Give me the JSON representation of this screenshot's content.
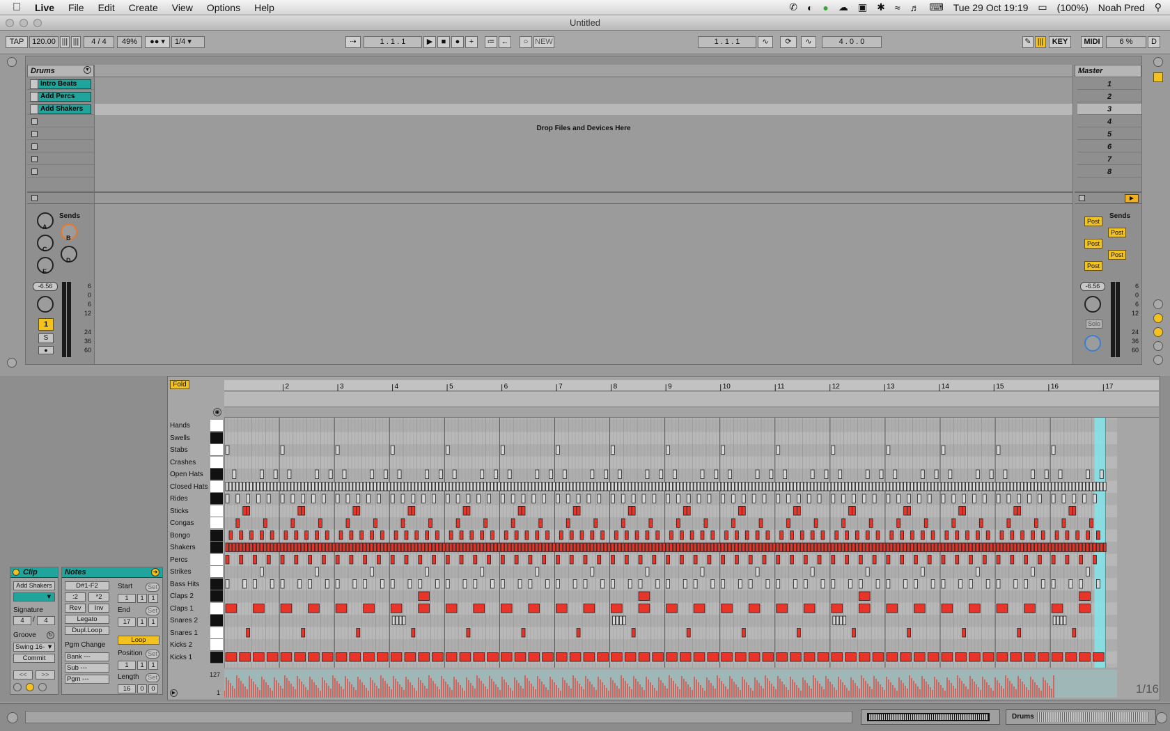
{
  "menubar": {
    "app": "Live",
    "items": [
      "File",
      "Edit",
      "Create",
      "View",
      "Options",
      "Help"
    ],
    "clock": "Tue 29 Oct  19:19",
    "battery": "(100%)",
    "user": "Noah Pred"
  },
  "window": {
    "title": "Untitled"
  },
  "transport": {
    "tap": "TAP",
    "tempo": "120.00",
    "signature": "4 / 4",
    "cpu_zoom": "49%",
    "quantize": "1/4",
    "song_position": "1 .  1 .  1",
    "new": "NEW",
    "loop_start": "1 .  1 .  1",
    "loop_length": "4 .  0 .  0",
    "key": "KEY",
    "midi": "MIDI",
    "cpu": "6 %",
    "d": "D"
  },
  "session": {
    "track_name": "Drums",
    "master_name": "Master",
    "clips": [
      "Intro Beats",
      "Add Percs",
      "Add Shakers"
    ],
    "drop_text": "Drop Files and Devices Here",
    "scenes": [
      "1",
      "2",
      "3",
      "4",
      "5",
      "6",
      "7",
      "8"
    ],
    "sends_label": "Sends",
    "send_knobs": [
      "A",
      "B",
      "C",
      "D",
      "E"
    ],
    "volume": "-6.56",
    "master_volume": "-6.56",
    "track_number": "1",
    "solo": "S",
    "master_solo": "Solo",
    "post": [
      "Post",
      "Post",
      "Post",
      "Post",
      "Post"
    ],
    "meter_scale": [
      "6",
      "0",
      "6",
      "12",
      "24",
      "36",
      "60"
    ]
  },
  "clip_panel": {
    "title": "Clip",
    "name": "Add Shakers",
    "signature_label": "Signature",
    "sig_num": "4",
    "sig_den": "4",
    "groove_label": "Groove",
    "groove": "Swing 16-",
    "commit": "Commit"
  },
  "notes_panel": {
    "title": "Notes",
    "range": "D#1-F2",
    "half": ":2",
    "double": "*2",
    "rev": "Rev",
    "inv": "Inv",
    "legato": "Legato",
    "dupl": "Dupl.Loop",
    "start_label": "Start",
    "start": [
      "1",
      "1",
      "1"
    ],
    "end_label": "End",
    "end": [
      "17",
      "1",
      "1"
    ],
    "loop": "Loop",
    "pgm_label": "Pgm Change",
    "bank": "Bank ---",
    "sub": "Sub ---",
    "pgm": "Pgm ---",
    "position_label": "Position",
    "position": [
      "1",
      "1",
      "1"
    ],
    "length_label": "Length",
    "length": [
      "16",
      "0",
      "0"
    ],
    "set": "Set"
  },
  "midi_editor": {
    "fold": "Fold",
    "bars": [
      "2",
      "3",
      "4",
      "5",
      "6",
      "7",
      "8",
      "9",
      "10",
      "11",
      "12",
      "13",
      "14",
      "15",
      "16",
      "17"
    ],
    "lanes": [
      "Hands",
      "Swells",
      "Stabs",
      "Crashes",
      "Open Hats",
      "Closed Hats",
      "Rides",
      "Sticks",
      "Congas",
      "Bongo",
      "Shakers",
      "Percs",
      "Strikes",
      "Bass Hits",
      "Claps 2",
      "Claps 1",
      "Snares 2",
      "Snares 1",
      "Kicks 2",
      "Kicks 1"
    ],
    "velocity_max": "127",
    "velocity_min": "1",
    "grid": "1/16",
    "clip_label": "Drums"
  },
  "colors": {
    "teal": "#1fa59b",
    "red": "#e8352a",
    "yellow": "#f3c21d",
    "loop": "#7fe9ee"
  }
}
